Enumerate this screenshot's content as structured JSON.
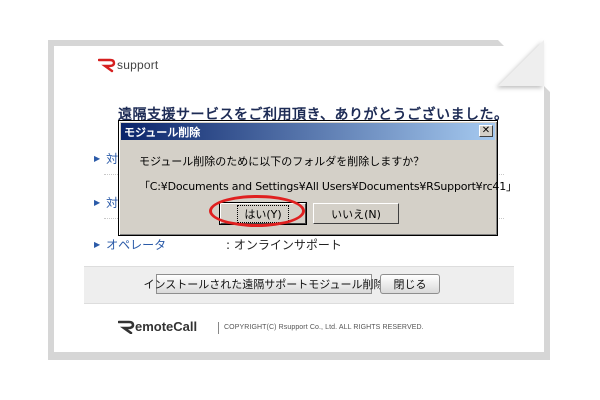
{
  "brand": {
    "logo_text": "support",
    "footer_logo_text": "emoteCall",
    "copyright": "COPYRIGHT(C) Rsupport Co., Ltd. ALL RIGHTS RESERVED."
  },
  "page": {
    "welcome": "遠隔支援サービスをご利用頂き、ありがとうございました。",
    "info_rows": [
      {
        "label": "対",
        "value": ""
      },
      {
        "label": "対",
        "value": ""
      },
      {
        "label": "オペレータ",
        "value": ": オンラインサポート"
      }
    ],
    "buttons": {
      "remove_module": "インストールされた遠隔サポートモジュール削除",
      "close": "閉じる"
    }
  },
  "dialog": {
    "title": "モジュール削除",
    "close_glyph": "✕",
    "message": "モジュール削除のために以下のフォルダを削除しますか？",
    "path": "「C:¥Documents and Settings¥All Users¥Documents¥RSupport¥rc41」",
    "yes_label": "はい(Y)",
    "no_label": "いいえ(N)"
  },
  "colors": {
    "titlebar_start": "#0a246a",
    "titlebar_end": "#a6caf0",
    "accent_red": "#e02020",
    "link_blue": "#2a5aa8"
  }
}
